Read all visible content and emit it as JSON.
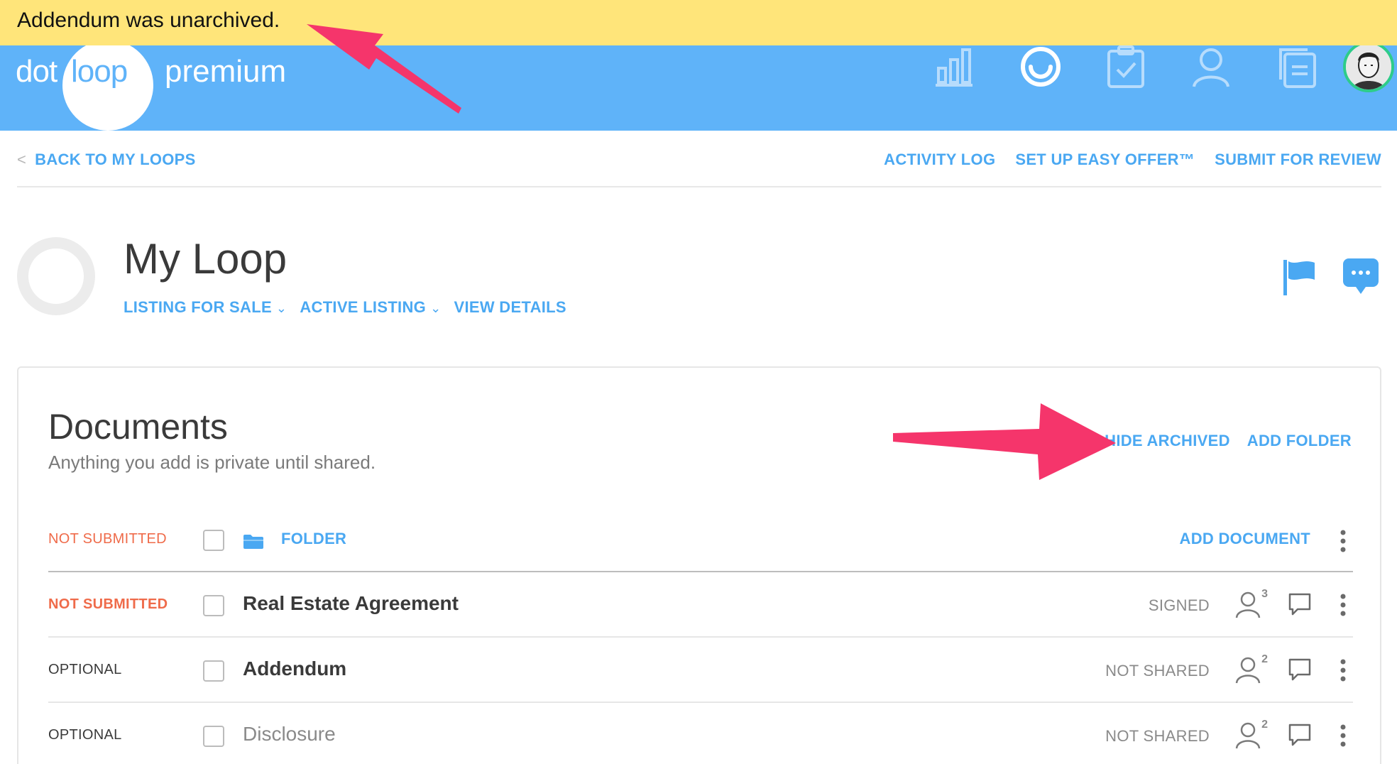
{
  "toast": {
    "message": "Addendum was unarchived."
  },
  "app": {
    "logo_dot": "dot",
    "logo_loop": "loop",
    "logo_premium": "premium",
    "nav_icons": [
      "reports-icon",
      "loop-progress-icon",
      "tasks-clipboard-icon",
      "profile-icon",
      "documents-icon"
    ],
    "brand_color": "#5fb3f9",
    "avatar_ring_color": "#2ecc8a"
  },
  "subnav": {
    "back_label": "BACK TO MY LOOPS",
    "back_chevron": "<",
    "actions": [
      "ACTIVITY LOG",
      "SET UP EASY OFFER™",
      "SUBMIT FOR REVIEW"
    ]
  },
  "loop": {
    "title": "My Loop",
    "transaction_type": "LISTING FOR SALE",
    "status": "ACTIVE LISTING",
    "view_details": "VIEW DETAILS"
  },
  "documents": {
    "title": "Documents",
    "subtitle": "Anything you add is private until shared.",
    "hide_archived": "HIDE ARCHIVED",
    "add_folder": "ADD FOLDER",
    "folder_row": {
      "status": "NOT SUBMITTED",
      "name": "FOLDER",
      "add_document": "ADD DOCUMENT"
    },
    "rows": [
      {
        "status": "NOT SUBMITTED",
        "name": "Real Estate Agreement",
        "share_status": "SIGNED",
        "participants": "3"
      },
      {
        "status": "OPTIONAL",
        "name": "Addendum",
        "share_status": "NOT SHARED",
        "participants": "2"
      },
      {
        "status": "OPTIONAL",
        "name": "Disclosure",
        "share_status": "NOT SHARED",
        "participants": "2"
      }
    ]
  },
  "colors": {
    "link": "#4aa8f2",
    "not_submitted": "#ef6b4a",
    "toast_bg": "#ffe57a",
    "annotation_arrow": "#f5356b"
  }
}
